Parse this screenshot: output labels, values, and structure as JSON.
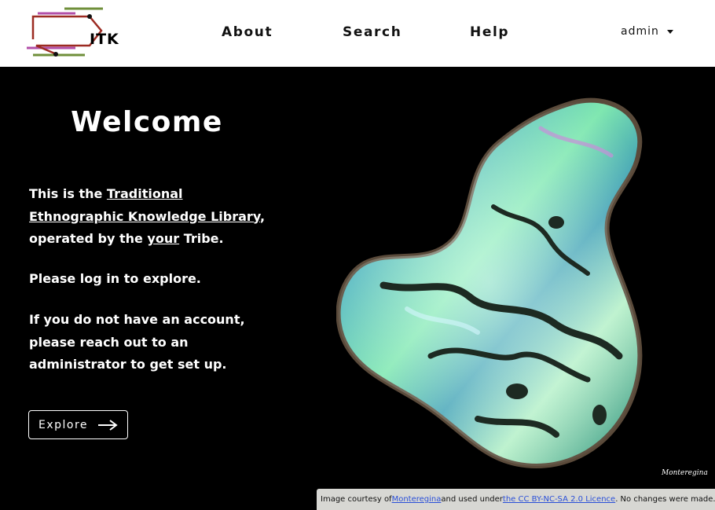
{
  "header": {
    "logo_text": "ITK",
    "nav": [
      {
        "label": "About"
      },
      {
        "label": "Search"
      },
      {
        "label": "Help"
      }
    ],
    "user": "admin"
  },
  "hero": {
    "title": "Welcome",
    "intro_prefix": "This is the ",
    "library_link": "Traditional Ethnographic Knowledge Library",
    "intro_mid": ",",
    "intro_operated": "operated by the ",
    "tribe_link": "your",
    "intro_suffix": " Tribe.",
    "login_text": "Please log in to explore.",
    "account_text": "If you do not have an account, please reach out to an administrator to get set up.",
    "explore_label": "Explore",
    "signature": "Monteregina"
  },
  "credit": {
    "prefix": "Image courtesy of ",
    "author_link": "Monteregina",
    "mid": " and used under ",
    "licence_link": "the CC BY-NC-SA 2.0 Licence",
    "suffix": ". No changes were made."
  },
  "colors": {
    "logo_purple": "#b24fa8",
    "logo_green": "#6f8f3a",
    "logo_red": "#9c2b22",
    "link_blue": "#2a4fd8"
  },
  "icons": {
    "caret": "chevron-down-icon",
    "explore_arrow": "arrow-right-icon"
  }
}
